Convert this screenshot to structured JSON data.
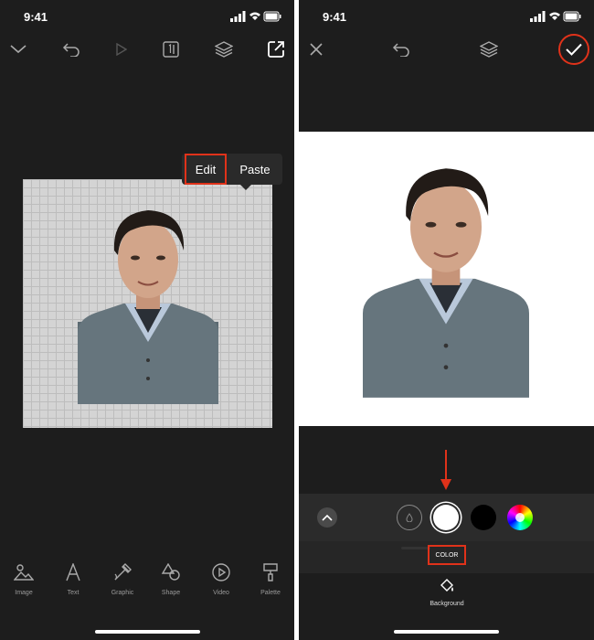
{
  "left_screen": {
    "status": {
      "time": "9:41"
    },
    "top_bar": {
      "icons": [
        "chevron-down-icon",
        "undo-icon",
        "play-icon",
        "frame-icon",
        "layers-icon",
        "share-icon"
      ]
    },
    "context_menu": {
      "edit_label": "Edit",
      "paste_label": "Paste"
    },
    "toolbar": {
      "items": [
        {
          "label": "Image",
          "icon": "image-icon"
        },
        {
          "label": "Text",
          "icon": "text-icon"
        },
        {
          "label": "Graphic",
          "icon": "graphic-icon"
        },
        {
          "label": "Shape",
          "icon": "shape-icon"
        },
        {
          "label": "Video",
          "icon": "video-icon"
        },
        {
          "label": "Palette",
          "icon": "palette-icon"
        }
      ]
    }
  },
  "right_screen": {
    "status": {
      "time": "9:41"
    },
    "top_bar": {
      "icons": [
        "close-icon",
        "undo-icon",
        "layers-icon",
        "checkmark-icon"
      ]
    },
    "color_panel": {
      "swatches": [
        {
          "name": "transparent",
          "color": ""
        },
        {
          "name": "white",
          "color": "#ffffff"
        },
        {
          "name": "black",
          "color": "#000000"
        },
        {
          "name": "color-wheel",
          "color": ""
        }
      ],
      "active_tab": "COLOR"
    },
    "bottom": {
      "label": "Background"
    }
  },
  "colors": {
    "highlight": "#e0321a",
    "background": "#1d1d1d"
  }
}
